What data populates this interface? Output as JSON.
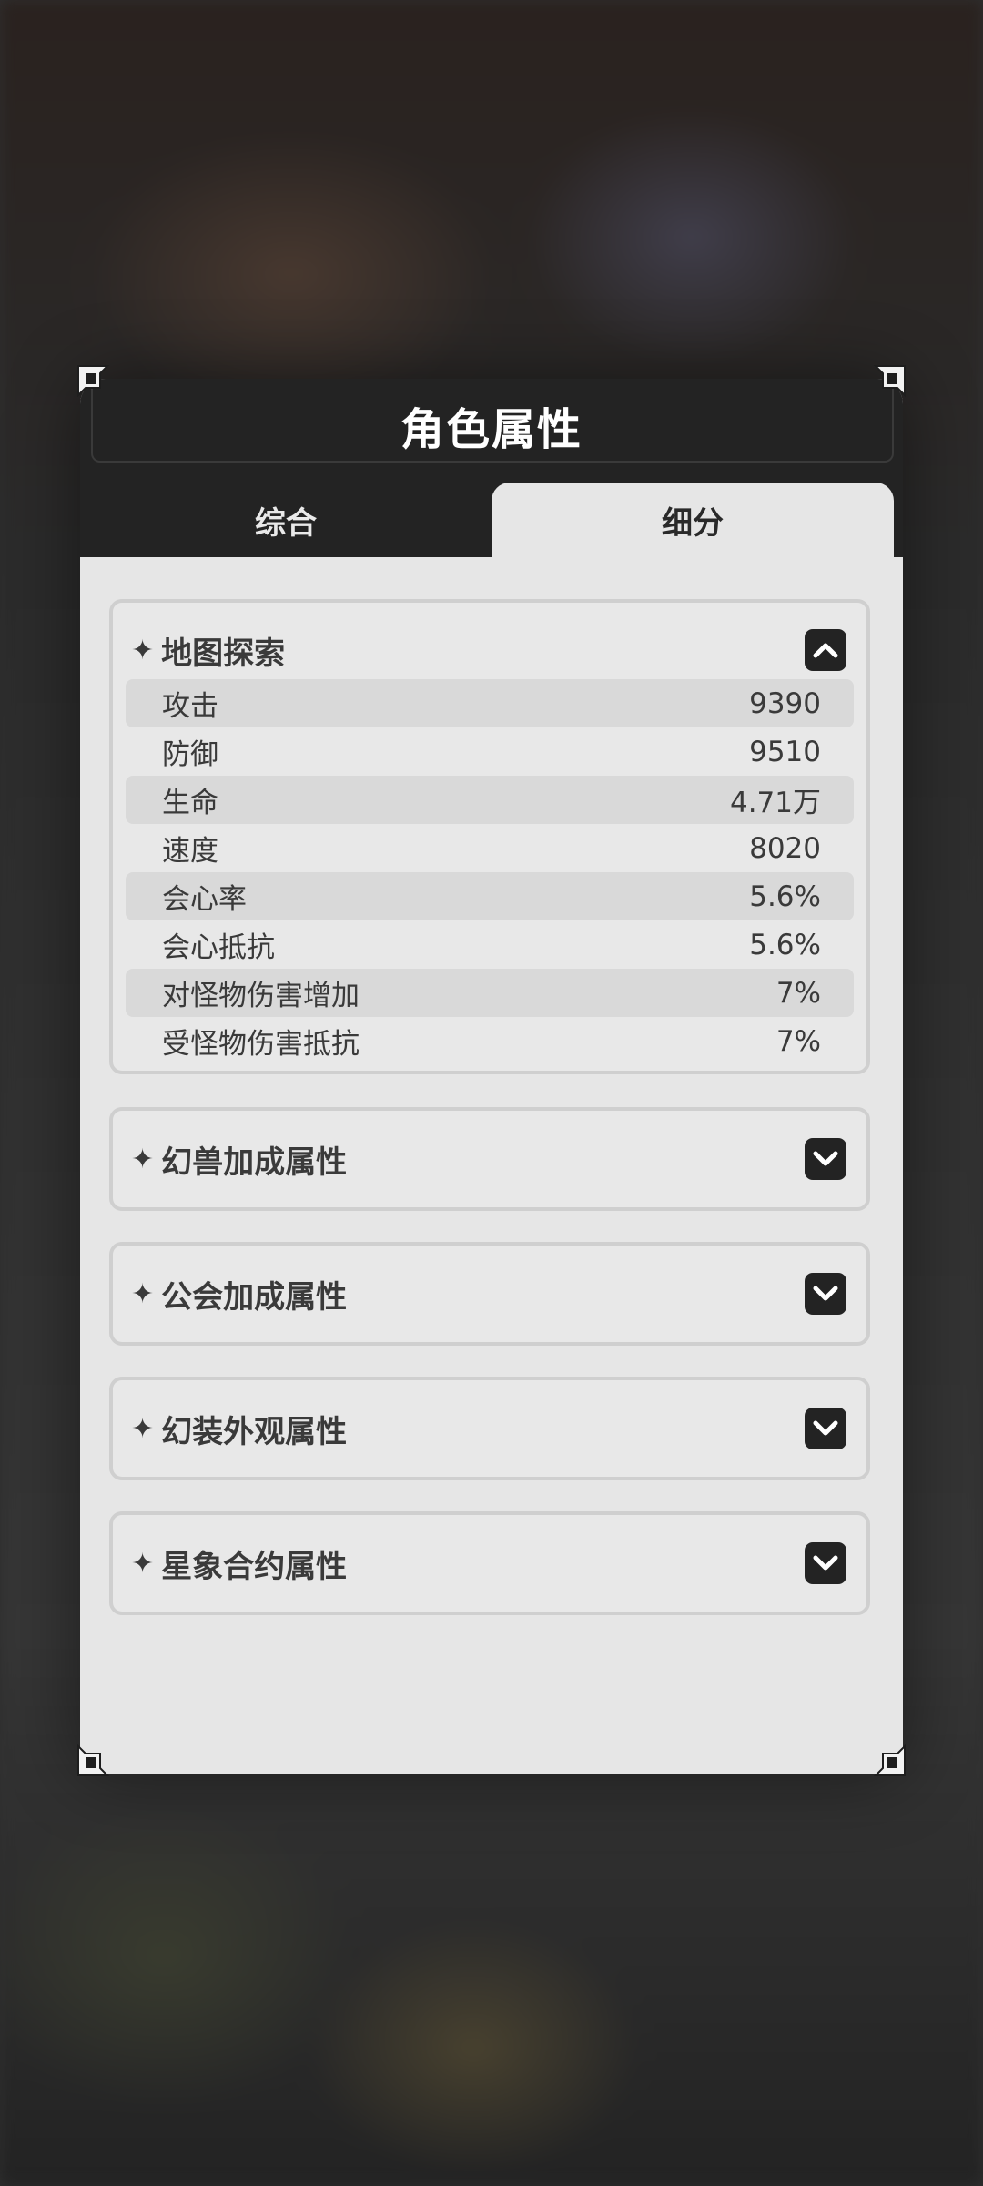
{
  "panel": {
    "title": "角色属性",
    "tabs": [
      {
        "label": "综合",
        "active": false
      },
      {
        "label": "细分",
        "active": true
      }
    ]
  },
  "sections": [
    {
      "title": "地图探索",
      "expanded": true,
      "toggle_icon": "chevron-up-icon",
      "rows": [
        {
          "label": "攻击",
          "value": "9390"
        },
        {
          "label": "防御",
          "value": "9510"
        },
        {
          "label": "生命",
          "value": "4.71万"
        },
        {
          "label": "速度",
          "value": "8020"
        },
        {
          "label": "会心率",
          "value": "5.6%"
        },
        {
          "label": "会心抵抗",
          "value": "5.6%"
        },
        {
          "label": "对怪物伤害增加",
          "value": "7%"
        },
        {
          "label": "受怪物伤害抵抗",
          "value": "7%"
        }
      ]
    },
    {
      "title": "幻兽加成属性",
      "expanded": false,
      "toggle_icon": "chevron-down-icon"
    },
    {
      "title": "公会加成属性",
      "expanded": false,
      "toggle_icon": "chevron-down-icon"
    },
    {
      "title": "幻装外观属性",
      "expanded": false,
      "toggle_icon": "chevron-down-icon"
    },
    {
      "title": "星象合约属性",
      "expanded": false,
      "toggle_icon": "chevron-down-icon"
    }
  ],
  "icons": {
    "bullet": "sparkle-icon",
    "corner": "corner-ornament-icon"
  },
  "colors": {
    "header_bg": "#232323",
    "panel_bg": "#e6e6e6",
    "row_shade": "#d9d9d9",
    "text": "#3a3a3a"
  }
}
